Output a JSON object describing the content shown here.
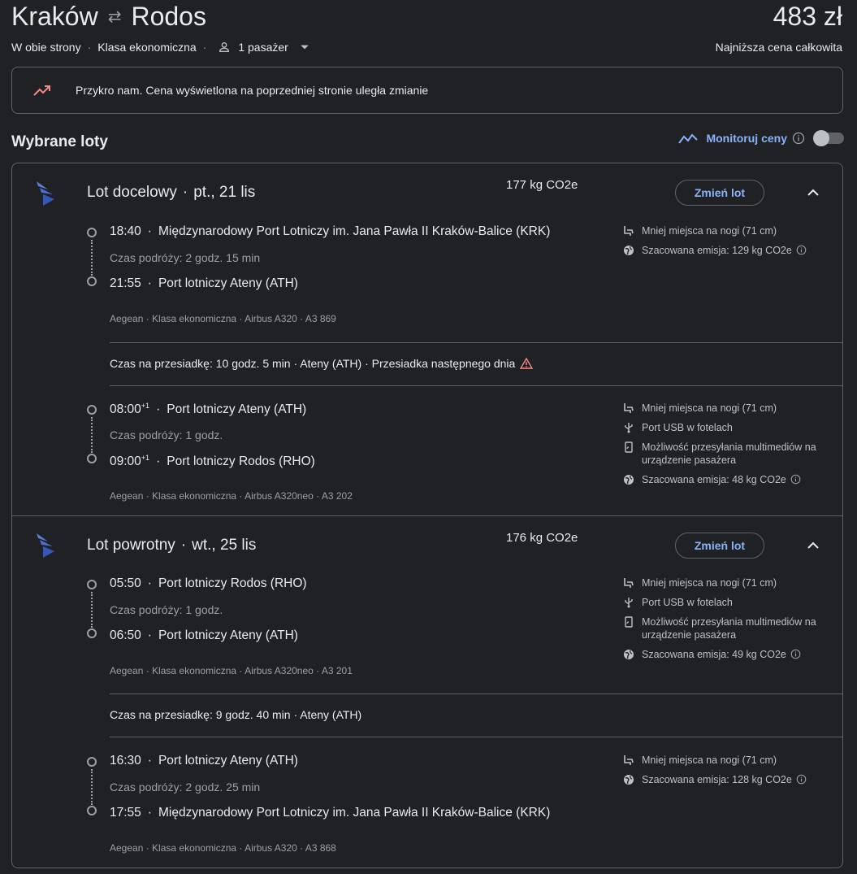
{
  "header": {
    "origin": "Kraków",
    "destination": "Rodos",
    "price": "483 zł",
    "trip_type": "W obie strony",
    "cabin_class": "Klasa ekonomiczna",
    "passengers": "1 pasażer",
    "price_label": "Najniższa cena całkowita"
  },
  "alert": {
    "text": "Przykro nam. Cena wyświetlona na poprzedniej stronie uległa zmianie"
  },
  "section": {
    "title": "Wybrane loty",
    "monitor_label": "Monitoruj ceny"
  },
  "outbound": {
    "title": "Lot docelowy",
    "date": "pt., 21 lis",
    "co2": "177 kg CO2e",
    "change_label": "Zmień lot",
    "segment1": {
      "dep_time": "18:40",
      "dep_airport": "Międzynarodowy Port Lotniczy im. Jana Pawła II Kraków-Balice (KRK)",
      "duration": "Czas podróży: 2 godz. 15 min",
      "arr_time": "21:55",
      "arr_airport": "Port lotniczy Ateny (ATH)",
      "meta": "Aegean · Klasa ekonomiczna · Airbus A320 · A3 869",
      "amenities": {
        "legroom": "Mniej miejsca na nogi (71 cm)",
        "emission": "Szacowana emisja: 129 kg CO2e"
      }
    },
    "layover": "Czas na przesiadkę: 10 godz. 5 min · Ateny (ATH) · Przesiadka następnego dnia",
    "segment2": {
      "dep_time": "08:00",
      "dep_sup": "+1",
      "dep_airport": "Port lotniczy Ateny (ATH)",
      "duration": "Czas podróży: 1 godz.",
      "arr_time": "09:00",
      "arr_sup": "+1",
      "arr_airport": "Port lotniczy Rodos (RHO)",
      "meta": "Aegean · Klasa ekonomiczna · Airbus A320neo · A3 202",
      "amenities": {
        "legroom": "Mniej miejsca na nogi (71 cm)",
        "usb": "Port USB w fotelach",
        "streaming": "Możliwość przesyłania multimediów na urządzenie pasażera",
        "emission": "Szacowana emisja: 48 kg CO2e"
      }
    }
  },
  "return": {
    "title": "Lot powrotny",
    "date": "wt., 25 lis",
    "co2": "176 kg CO2e",
    "change_label": "Zmień lot",
    "segment1": {
      "dep_time": "05:50",
      "dep_airport": "Port lotniczy Rodos (RHO)",
      "duration": "Czas podróży: 1 godz.",
      "arr_time": "06:50",
      "arr_airport": "Port lotniczy Ateny (ATH)",
      "meta": "Aegean · Klasa ekonomiczna · Airbus A320neo · A3 201",
      "amenities": {
        "legroom": "Mniej miejsca na nogi (71 cm)",
        "usb": "Port USB w fotelach",
        "streaming": "Możliwość przesyłania multimediów na urządzenie pasażera",
        "emission": "Szacowana emisja: 49 kg CO2e"
      }
    },
    "layover": "Czas na przesiadkę: 9 godz. 40 min · Ateny (ATH)",
    "segment2": {
      "dep_time": "16:30",
      "dep_airport": "Port lotniczy Ateny (ATH)",
      "duration": "Czas podróży: 2 godz. 25 min",
      "arr_time": "17:55",
      "arr_airport": "Międzynarodowy Port Lotniczy im. Jana Pawła II Kraków-Balice (KRK)",
      "meta": "Aegean · Klasa ekonomiczna · Airbus A320 · A3 868",
      "amenities": {
        "legroom": "Mniej miejsca na nogi (71 cm)",
        "emission": "Szacowana emisja: 128 kg CO2e"
      }
    }
  },
  "colors": {
    "background": "#202124",
    "accent": "#8ab4f8",
    "border": "#5f6368",
    "trend_red": "#f28b82",
    "warning": "#f28b82"
  },
  "icons": [
    "swap-icon",
    "person-icon",
    "dropdown-icon",
    "trend-up-icon",
    "chart-line-icon",
    "info-icon",
    "toggle-switch",
    "aegean-logo",
    "chevron-up-icon",
    "seat-icon",
    "globe-icon",
    "usb-icon",
    "stream-device-icon",
    "warning-icon"
  ]
}
